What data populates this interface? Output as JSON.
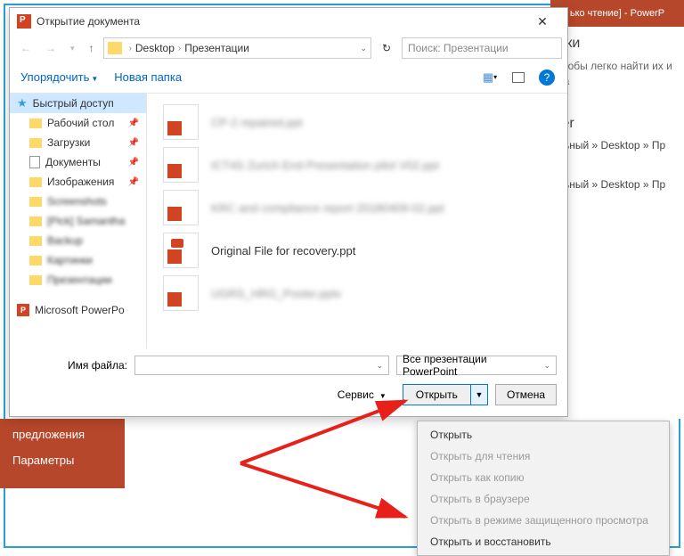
{
  "bg": {
    "titlebar": "ько чтение]  -  PowerP",
    "header1": "лки",
    "desc1": "чтобы легко найти их и на",
    "header2": "ter",
    "path1": "льный » Desktop » Пр",
    "path2": "льный » Desktop » Пр",
    "left_items": [
      "предложения",
      "Параметры"
    ]
  },
  "dialog": {
    "title": "Открытие документа",
    "close": "✕",
    "crumbs": [
      "Desktop",
      "Презентации"
    ],
    "search_placeholder": "Поиск: Презентации",
    "organize": "Упорядочить",
    "new_folder": "Новая папка",
    "sidebar": [
      {
        "label": "Быстрый доступ",
        "kind": "star",
        "sel": true
      },
      {
        "label": "Рабочий стол",
        "kind": "folder",
        "sub": true,
        "pin": true
      },
      {
        "label": "Загрузки",
        "kind": "folder",
        "sub": true,
        "pin": true
      },
      {
        "label": "Документы",
        "kind": "doc",
        "sub": true,
        "pin": true
      },
      {
        "label": "Изображения",
        "kind": "folder",
        "sub": true,
        "pin": true
      },
      {
        "label": "Screenshots",
        "kind": "folder",
        "sub": true,
        "blur": true
      },
      {
        "label": "[Pick] Samantha",
        "kind": "folder",
        "sub": true,
        "blur": true
      },
      {
        "label": "Backup",
        "kind": "folder",
        "sub": true,
        "blur": true
      },
      {
        "label": "Картинки",
        "kind": "folder",
        "sub": true,
        "blur": true
      },
      {
        "label": "Презентации",
        "kind": "folder",
        "sub": true,
        "blur": true
      },
      {
        "label": "Microsoft PowerPo",
        "kind": "ppt",
        "gap": true
      }
    ],
    "files": [
      {
        "name": "CP-2 repaired.ppt",
        "blur": true
      },
      {
        "name": "ICT4S Zurich End Presentation pilot V02.ppt",
        "blur": true
      },
      {
        "name": "KRC and compliance report 20180409-02.ppt",
        "blur": true
      },
      {
        "name": "Original File for recovery.ppt",
        "blur": false
      },
      {
        "name": "UGRS_HRG_Poster.pptx",
        "blur": true
      }
    ],
    "filename_label": "Имя файла:",
    "filter": "Все презентации PowerPoint",
    "tools": "Сервис",
    "open": "Открыть",
    "cancel": "Отмена"
  },
  "menu": {
    "items": [
      {
        "label": "Открыть",
        "enabled": true
      },
      {
        "label": "Открыть для чтения",
        "enabled": false
      },
      {
        "label": "Открыть как копию",
        "enabled": false
      },
      {
        "label": "Открыть в браузере",
        "enabled": false
      },
      {
        "label": "Открыть в режиме защищенного просмотра",
        "enabled": false
      },
      {
        "label": "Открыть и восстановить",
        "enabled": true
      }
    ]
  }
}
